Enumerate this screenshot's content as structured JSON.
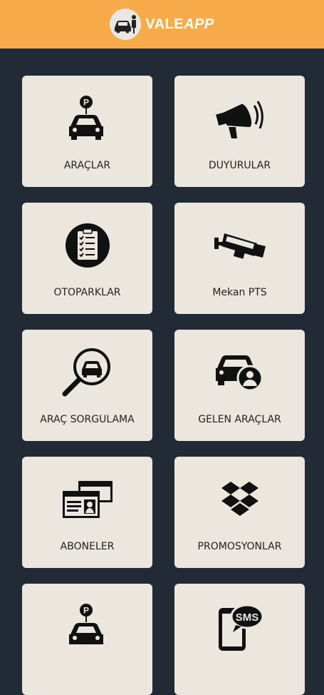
{
  "header": {
    "brand_part1": "VALE",
    "brand_part2": "APP"
  },
  "tiles": [
    {
      "label": "ARAÇLAR",
      "icon": "parked-car-icon"
    },
    {
      "label": "DUYURULAR",
      "icon": "megaphone-icon"
    },
    {
      "label": "OTOPARKLAR",
      "icon": "checklist-icon"
    },
    {
      "label": "Mekan PTS",
      "icon": "security-camera-icon"
    },
    {
      "label": "ARAÇ SORGULAMA",
      "icon": "car-search-icon"
    },
    {
      "label": "GELEN ARAÇLAR",
      "icon": "car-user-icon"
    },
    {
      "label": "ABONELER",
      "icon": "id-cards-icon"
    },
    {
      "label": "PROMOSYONLAR",
      "icon": "dropbox-icon"
    },
    {
      "label": "",
      "icon": "parked-car-icon"
    },
    {
      "label": "",
      "icon": "sms-phone-icon"
    }
  ],
  "sms_badge": "SMS",
  "parking_badge": "P"
}
